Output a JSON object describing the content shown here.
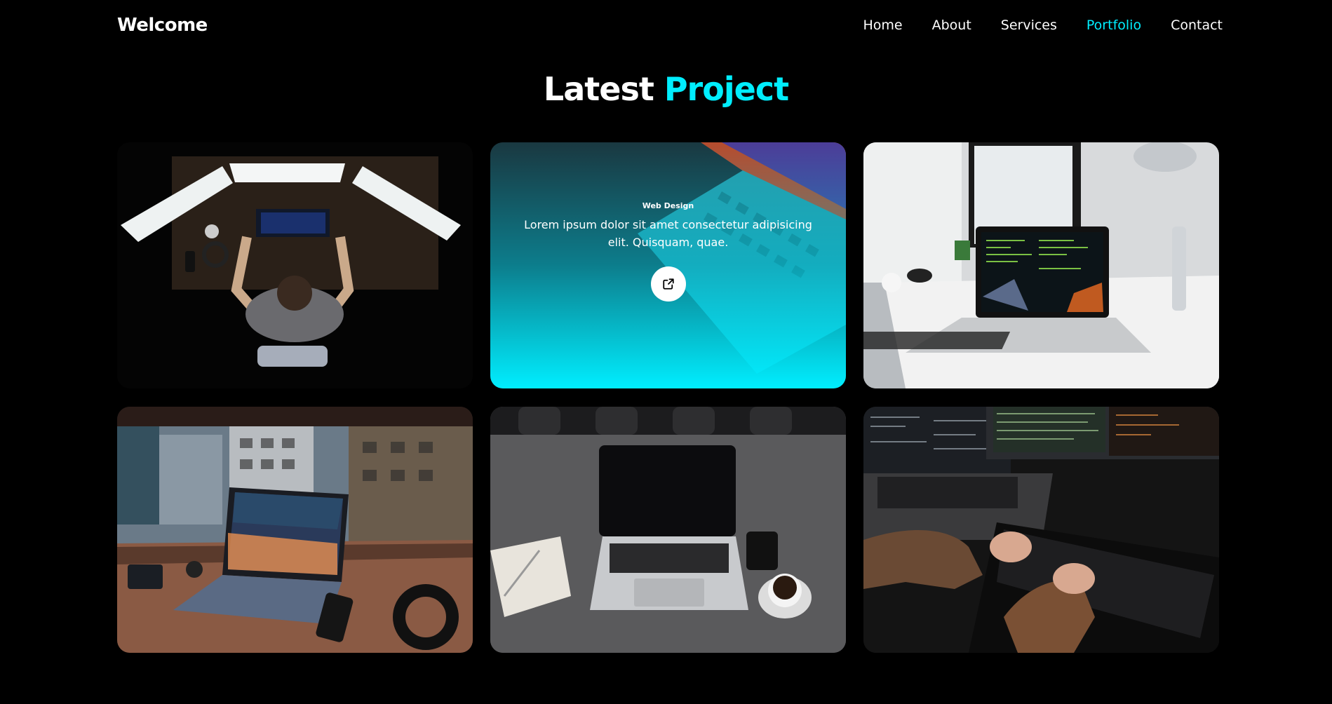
{
  "header": {
    "logo": "Welcome",
    "nav": [
      {
        "label": "Home",
        "active": false
      },
      {
        "label": "About",
        "active": false
      },
      {
        "label": "Services",
        "active": false
      },
      {
        "label": "Portfolio",
        "active": true
      },
      {
        "label": "Contact",
        "active": false
      }
    ]
  },
  "section": {
    "title_main": "Latest",
    "title_accent": "Project"
  },
  "portfolio": {
    "hover_card": {
      "category": "Web Design",
      "description": "Lorem ipsum dolor sit amet consectetur adipisicing elit. Quisquam, quae.",
      "link_icon": "external-link-icon"
    }
  },
  "colors": {
    "background": "#000000",
    "accent": "#00eeff",
    "text": "#ffffff"
  }
}
